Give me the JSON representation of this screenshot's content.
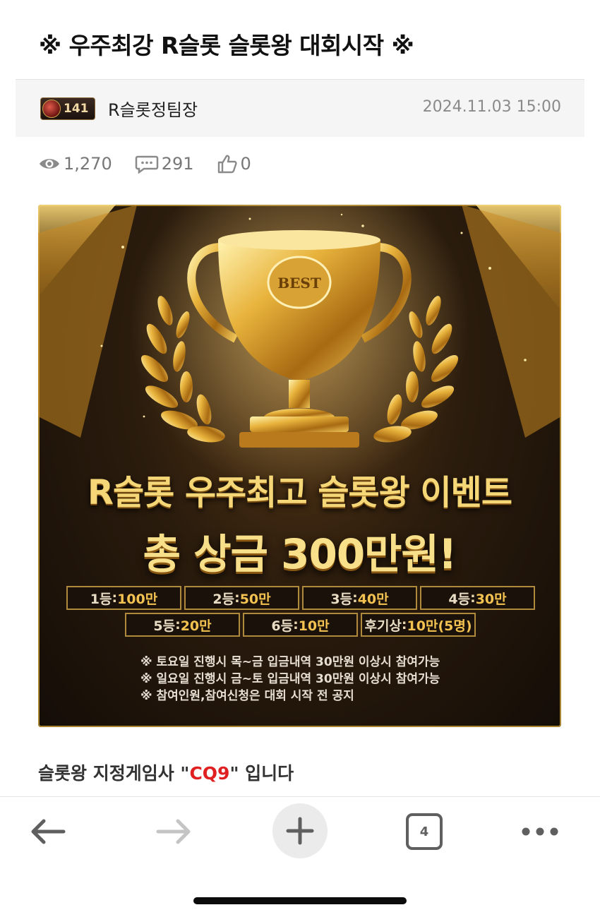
{
  "post": {
    "title": "※ 우주최강 R슬롯 슬롯왕 대회시작 ※",
    "author": {
      "level": "141",
      "name": "R슬롯정팀장"
    },
    "date": "2024.11.03 15:00",
    "stats": {
      "views": "1,270",
      "comments": "291",
      "likes": "0"
    }
  },
  "banner": {
    "trophy_label": "BEST",
    "event_title": "R슬롯 우주최고 슬롯왕 이벤트",
    "prize_total": "총 상금 300만원!",
    "prizes_row1": [
      {
        "rank": "1등",
        "amount": "100만"
      },
      {
        "rank": "2등",
        "amount": "50만"
      },
      {
        "rank": "3등",
        "amount": "40만"
      },
      {
        "rank": "4등",
        "amount": "30만"
      }
    ],
    "prizes_row2": [
      {
        "rank": "5등",
        "amount": "20만"
      },
      {
        "rank": "6등",
        "amount": "10만"
      },
      {
        "rank": "후기상",
        "amount": "10만(5명)"
      }
    ],
    "notes": [
      "※ 토요일 진행시 목~금 입금내역 30만원 이상시 참여가능",
      "※ 일요일 진행시 금~토 입금내역 30만원 이상시 참여가능",
      "※ 참여인원,참여신청은 대회 시작 전 공지"
    ]
  },
  "content": {
    "prefix": "슬롯왕 지정게임사 \"",
    "highlight": "CQ9",
    "suffix": "\" 입니다",
    "highlight_color": "#e02020"
  },
  "browser_toolbar": {
    "tab_count": "4",
    "icons": [
      "back-arrow-icon",
      "forward-arrow-icon",
      "plus-icon",
      "tabs-icon",
      "more-dots-icon"
    ]
  }
}
